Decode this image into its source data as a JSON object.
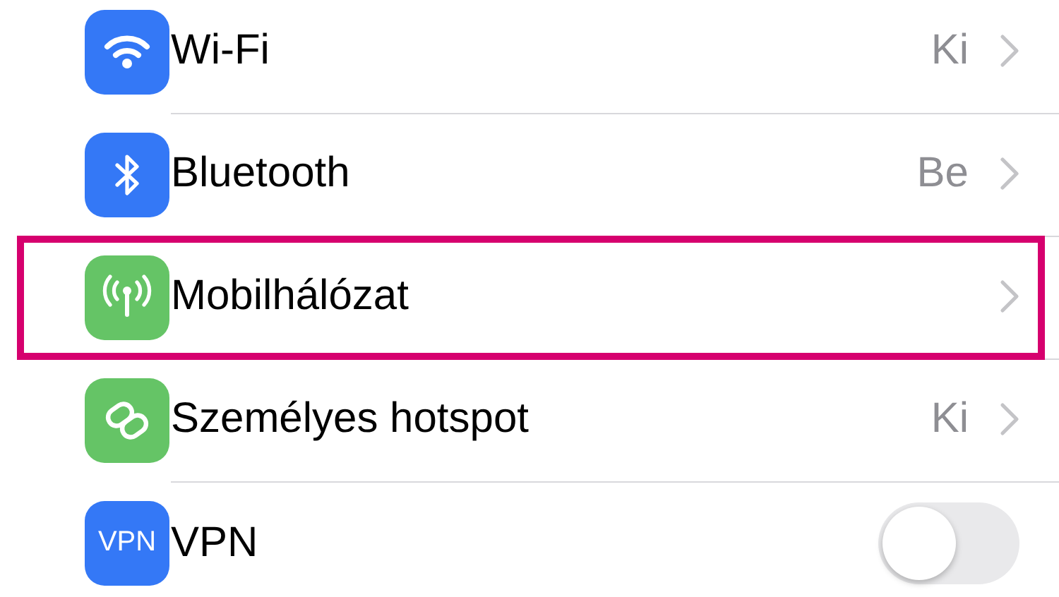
{
  "rows": [
    {
      "kind": "link",
      "label": "Wi-Fi",
      "value": "Ki",
      "highlighted": false
    },
    {
      "kind": "link",
      "label": "Bluetooth",
      "value": "Be",
      "highlighted": false
    },
    {
      "kind": "link",
      "label": "Mobilhálózat",
      "highlighted": true
    },
    {
      "kind": "link",
      "label": "Személyes hotspot",
      "value": "Ki",
      "highlighted": false
    },
    {
      "kind": "toggle",
      "icon_text": "VPN",
      "label": "VPN",
      "on": false,
      "highlighted": false
    }
  ]
}
